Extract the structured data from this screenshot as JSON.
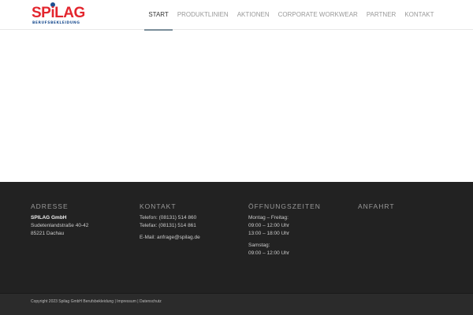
{
  "logo": {
    "word": "SPiLAG",
    "sub": "BERUFSBEKLEIDUNG"
  },
  "nav": [
    "START",
    "PRODUKTLINIEN",
    "AKTIONEN",
    "CORPORATE WORKWEAR",
    "PARTNER",
    "KONTAKT"
  ],
  "footer": {
    "adresse": {
      "title": "ADRESSE",
      "name": "SPILAG GmbH",
      "street": "Sudetenlandstraße 40-42",
      "city": "85221 Dachau"
    },
    "kontakt": {
      "title": "KONTAKT",
      "tel": "Telefon: (08131) 514 860",
      "fax": "Telefax: (08131) 514 861",
      "email": "E-Mail: anfrage@spilag.de"
    },
    "zeiten": {
      "title": "ÖFFNUNGSZEITEN",
      "weekday": "Montag – Freitag:",
      "wd1": "09:00 – 12:00 Uhr",
      "wd2": "13:00 – 18:00 Uhr",
      "saturday": "Samstag:",
      "sat1": "09:00 – 12:00 Uhr"
    },
    "anfahrt": {
      "title": "ANFAHRT"
    }
  },
  "socket": {
    "copyright": "Copyright 2023 Spilag GmbH Berufsbekleidung | Impressum | Datenschutz"
  }
}
